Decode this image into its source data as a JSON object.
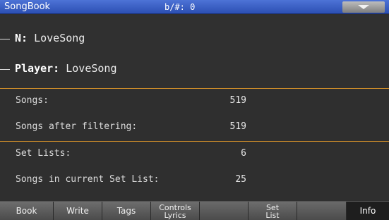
{
  "titlebar": {
    "title": "SongBook",
    "key_signature": "b/#: 0",
    "menu_icon": "triangle-down-icon"
  },
  "names": {
    "n_label": "N:",
    "n_value": "LoveSong",
    "player_label": "Player:",
    "player_value": "LoveSong"
  },
  "info": {
    "songs_label": "Songs:",
    "songs_value": "519",
    "filtered_label": "Songs after filtering:",
    "filtered_value": "519",
    "setlists_label": "Set Lists:",
    "setlists_value": "6",
    "current_setlist_label": "Songs in current Set List:",
    "current_setlist_value": "25"
  },
  "tabs": {
    "book": "Book",
    "write": "Write",
    "tags": "Tags",
    "controls_line1": "Controls",
    "controls_line2": "Lyrics",
    "setlist_line1": "Set",
    "setlist_line2": "List",
    "info": "Info"
  },
  "colors": {
    "titlebar": "#3d61c8",
    "divider": "#c88a2a",
    "background": "#2f2f2f"
  }
}
